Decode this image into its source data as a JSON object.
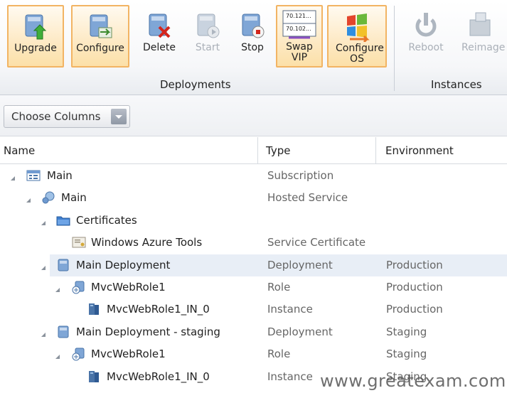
{
  "ribbon": {
    "buttons": [
      {
        "label": "Upgrade",
        "icon": "upgrade-icon"
      },
      {
        "label": "Configure",
        "icon": "configure-icon"
      },
      {
        "label": "Delete",
        "icon": "delete-icon"
      },
      {
        "label": "Start",
        "icon": "start-icon"
      },
      {
        "label": "Stop",
        "icon": "stop-icon"
      },
      {
        "label": "Swap VIP",
        "icon": "swap-vip-icon",
        "badge1": "70.121...",
        "badge2": "70.102..."
      },
      {
        "label": "Configure OS",
        "icon": "configure-os-icon"
      },
      {
        "label": "Reboot",
        "icon": "reboot-icon"
      },
      {
        "label": "Reimage",
        "icon": "reimage-icon"
      }
    ],
    "groups": {
      "deployments": "Deployments",
      "instances": "Instances"
    }
  },
  "toolbar": {
    "choose_columns": "Choose Columns"
  },
  "columns": {
    "name": "Name",
    "type": "Type",
    "environment": "Environment"
  },
  "rows": [
    {
      "name": "Main",
      "type": "Subscription",
      "env": ""
    },
    {
      "name": "Main",
      "type": "Hosted Service",
      "env": ""
    },
    {
      "name": "Certificates",
      "type": "",
      "env": ""
    },
    {
      "name": "Windows Azure Tools",
      "type": "Service Certificate",
      "env": ""
    },
    {
      "name": "Main Deployment",
      "type": "Deployment",
      "env": "Production"
    },
    {
      "name": "MvcWebRole1",
      "type": "Role",
      "env": "Production"
    },
    {
      "name": "MvcWebRole1_IN_0",
      "type": "Instance",
      "env": "Production"
    },
    {
      "name": "Main Deployment - staging",
      "type": "Deployment",
      "env": "Staging"
    },
    {
      "name": "MvcWebRole1",
      "type": "Role",
      "env": "Staging"
    },
    {
      "name": "MvcWebRole1_IN_0",
      "type": "Instance",
      "env": "Staging"
    }
  ],
  "watermark": "www.greatexam.com",
  "colors": {
    "highlight_border": "#f2b463",
    "selected_row": "#e8eef6"
  }
}
